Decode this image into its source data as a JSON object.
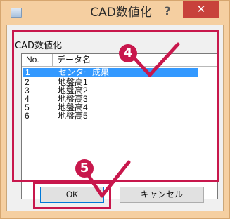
{
  "window": {
    "title": "CAD数値化",
    "help_label": "?",
    "close_label": "✕"
  },
  "group": {
    "label": "CAD数値化"
  },
  "list": {
    "columns": [
      "No.",
      "データ名"
    ],
    "rows": [
      {
        "no": "1",
        "name": "センター成果",
        "selected": true
      },
      {
        "no": "2",
        "name": "地盤高1"
      },
      {
        "no": "3",
        "name": "地盤高2"
      },
      {
        "no": "4",
        "name": "地盤高3"
      },
      {
        "no": "5",
        "name": "地盤高4"
      },
      {
        "no": "6",
        "name": "地盤高5"
      }
    ]
  },
  "buttons": {
    "ok": "OK",
    "cancel": "キャンセル"
  },
  "annotations": {
    "step4": "4",
    "step5": "5",
    "highlight_color": "#c8174c"
  },
  "colors": {
    "selection": "#3399ff",
    "close": "#c8423b",
    "frame": "#f5cfa1"
  }
}
